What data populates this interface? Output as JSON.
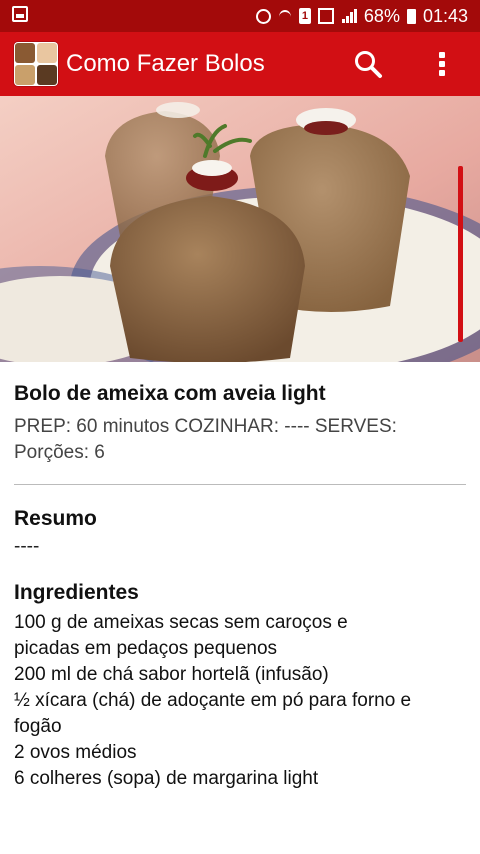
{
  "status_bar": {
    "battery": "68%",
    "time": "01:43",
    "sim_label": "1"
  },
  "app_bar": {
    "title": "Como Fazer Bolos",
    "icons": [
      "app-logo-icon",
      "search-icon",
      "overflow-menu-icon"
    ],
    "colors": {
      "app_bar": "#d20f14",
      "status_bar": "#a30a0a"
    }
  },
  "recipe": {
    "title": "Bolo de ameixa com aveia light",
    "meta_line_1": "PREP: 60 minutos  COZINHAR: ----  SERVES:",
    "meta_line_2": "Porções: 6",
    "summary_heading": "Resumo",
    "summary_text": "----",
    "ingredients_heading": "Ingredientes",
    "ingredients": [
      "100 g de ameixas secas sem caroços e",
      "picadas em pedaços pequenos",
      "200 ml de chá sabor hortelã (infusão)",
      "½ xícara (chá) de adoçante em pó para forno e",
      "fogão",
      "2 ovos médios",
      "6 colheres (sopa) de margarina light"
    ]
  }
}
